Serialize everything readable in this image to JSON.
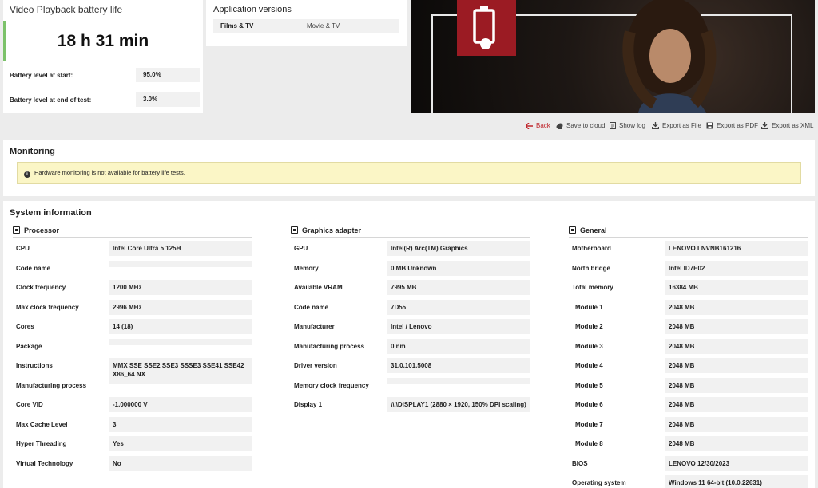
{
  "battery": {
    "title": "Video Playback battery life",
    "result": "18 h 31 min",
    "level_start_label": "Battery level at start:",
    "level_start_value": "95.0%",
    "level_end_label": "Battery level at end of test:",
    "level_end_value": "3.0%",
    "accent_color": "#7cc26a"
  },
  "app_versions": {
    "title": "Application versions",
    "rows": [
      {
        "name": "Films & TV",
        "value": "Movie & TV"
      }
    ]
  },
  "banner": {
    "badge_color": "#9b1b23",
    "icon": "battery-icon"
  },
  "toolbar": {
    "back": "Back",
    "save_cloud": "Save to cloud",
    "show_log": "Show log",
    "export_file": "Export as File",
    "export_pdf": "Export as PDF",
    "export_xml": "Export as XML"
  },
  "monitoring": {
    "title": "Monitoring",
    "note": "Hardware monitoring is not available for battery life tests."
  },
  "system_info": {
    "title": "System information",
    "processor": {
      "title": "Processor",
      "rows": [
        {
          "label": "CPU",
          "value": "Intel Core Ultra 5 125H"
        },
        {
          "label": "Code name",
          "value": ""
        },
        {
          "label": "Clock frequency",
          "value": "1200 MHz"
        },
        {
          "label": "Max clock frequency",
          "value": "2996 MHz"
        },
        {
          "label": "Cores",
          "value": "14 (18)"
        },
        {
          "label": "Package",
          "value": ""
        },
        {
          "label": "Instructions",
          "value": "MMX SSE SSE2 SSE3 SSSE3 SSE41 SSE42 X86_64 NX"
        },
        {
          "label": "Manufacturing process",
          "value": ""
        },
        {
          "label": "Core VID",
          "value": "-1.000000 V"
        },
        {
          "label": "Max Cache Level",
          "value": "3"
        },
        {
          "label": "Hyper Threading",
          "value": "Yes"
        },
        {
          "label": "Virtual Technology",
          "value": "No"
        }
      ]
    },
    "graphics": {
      "title": "Graphics adapter",
      "rows": [
        {
          "label": "GPU",
          "value": "Intel(R) Arc(TM) Graphics"
        },
        {
          "label": "Memory",
          "value": "0 MB Unknown"
        },
        {
          "label": "Available VRAM",
          "value": "7995 MB"
        },
        {
          "label": "Code name",
          "value": "7D55"
        },
        {
          "label": "Manufacturer",
          "value": "Intel / Lenovo"
        },
        {
          "label": "Manufacturing process",
          "value": "0 nm"
        },
        {
          "label": "Driver version",
          "value": "31.0.101.5008"
        },
        {
          "label": "Memory clock frequency",
          "value": ""
        },
        {
          "label": "Display 1",
          "value": "\\\\.\\DISPLAY1 (2880 × 1920, 150% DPI scaling)"
        }
      ]
    },
    "general": {
      "title": "General",
      "rows": [
        {
          "label": "Motherboard",
          "value": "LENOVO LNVNB161216"
        },
        {
          "label": "North bridge",
          "value": "Intel ID7E02"
        },
        {
          "label": "Total memory",
          "value": "16384 MB"
        },
        {
          "label": "Module 1",
          "value": "2048 MB"
        },
        {
          "label": "Module 2",
          "value": "2048 MB"
        },
        {
          "label": "Module 3",
          "value": "2048 MB"
        },
        {
          "label": "Module 4",
          "value": "2048 MB"
        },
        {
          "label": "Module 5",
          "value": "2048 MB"
        },
        {
          "label": "Module 6",
          "value": "2048 MB"
        },
        {
          "label": "Module 7",
          "value": "2048 MB"
        },
        {
          "label": "Module 8",
          "value": "2048 MB"
        },
        {
          "label": "BIOS",
          "value": "LENOVO 12/30/2023"
        },
        {
          "label": "Operating system",
          "value": "Windows 11 64-bit (10.0.22631)"
        }
      ]
    }
  }
}
